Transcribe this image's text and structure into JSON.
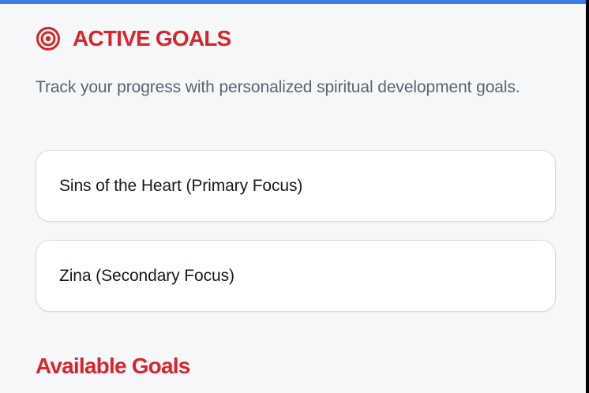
{
  "header": {
    "title": "ACTIVE GOALS",
    "icon": "target-icon",
    "accent_color": "#D6262B"
  },
  "description": "Track your progress with personalized spiritual development goals.",
  "active_goals": [
    {
      "label": "Sins of the Heart (Primary Focus)"
    },
    {
      "label": "Zina (Secondary Focus)"
    }
  ],
  "available_goals": {
    "title": "Available Goals"
  },
  "colors": {
    "top_bar": "#3F7BE0",
    "background": "#F6F7F9",
    "card_background": "#FFFFFF",
    "body_text": "#5B6472"
  }
}
